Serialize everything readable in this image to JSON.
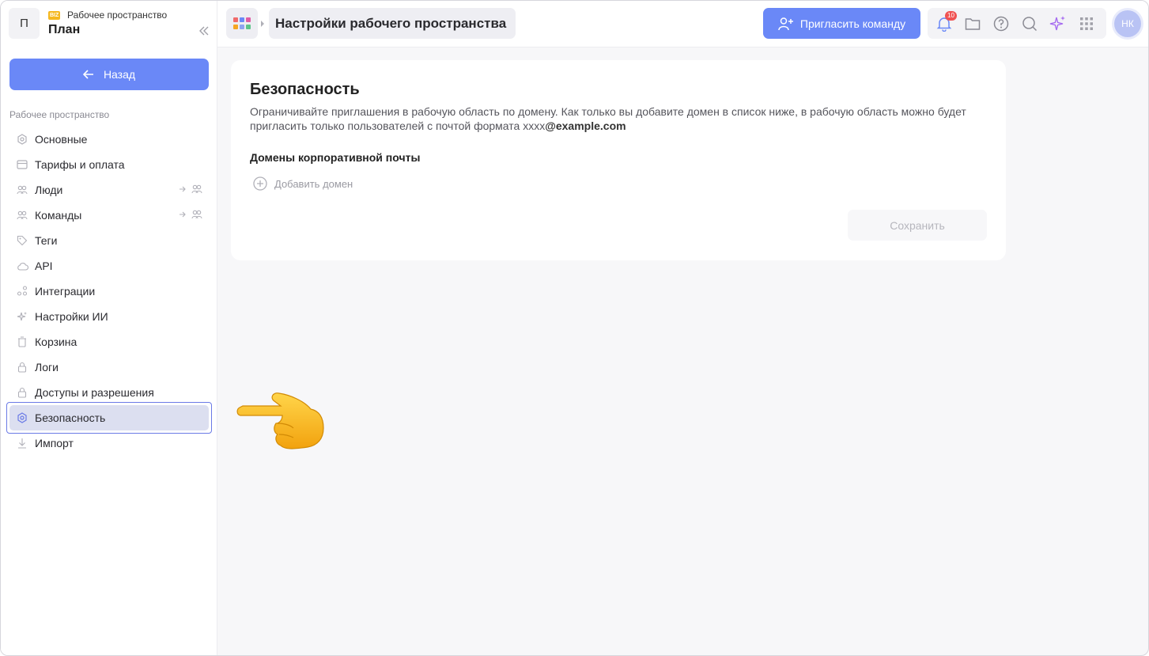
{
  "workspace": {
    "avatar_letter": "П",
    "badge": "BIZ",
    "subtitle": "Рабочее пространство",
    "title": "План"
  },
  "sidebar": {
    "back_label": "Назад",
    "section_label": "Рабочее пространство",
    "items": [
      {
        "label": "Основные",
        "icon": "gear-icon"
      },
      {
        "label": "Тарифы и оплата",
        "icon": "card-icon"
      },
      {
        "label": "Люди",
        "icon": "people-icon"
      },
      {
        "label": "Команды",
        "icon": "people-icon"
      },
      {
        "label": "Теги",
        "icon": "tag-icon"
      },
      {
        "label": "API",
        "icon": "cloud-icon"
      },
      {
        "label": "Интеграции",
        "icon": "integrations-icon"
      },
      {
        "label": "Настройки ИИ",
        "icon": "sparkle-icon"
      },
      {
        "label": "Корзина",
        "icon": "trash-icon"
      },
      {
        "label": "Логи",
        "icon": "lock-icon"
      },
      {
        "label": "Доступы и разрешения",
        "icon": "lock-icon"
      },
      {
        "label": "Безопасность",
        "icon": "gear-icon",
        "active": true
      },
      {
        "label": "Импорт",
        "icon": "download-icon"
      }
    ]
  },
  "topbar": {
    "breadcrumb": "Настройки рабочего пространства",
    "invite_label": "Пригласить команду",
    "notifications_count": "10",
    "user_initials": "НК"
  },
  "security": {
    "title": "Безопасность",
    "description": "Ограничивайте приглашения в рабочую область по домену. Как только вы добавите домен в список ниже, в рабочую область можно будет пригласить только пользователей с почтой формата xxxx",
    "description_example": "@example.com",
    "domains_label": "Домены корпоративной почты",
    "add_domain_label": "Добавить домен",
    "save_label": "Сохранить"
  },
  "colors": {
    "accent": "#6a88f7",
    "active_bg": "#dcdff0",
    "badge": "#f05252"
  }
}
